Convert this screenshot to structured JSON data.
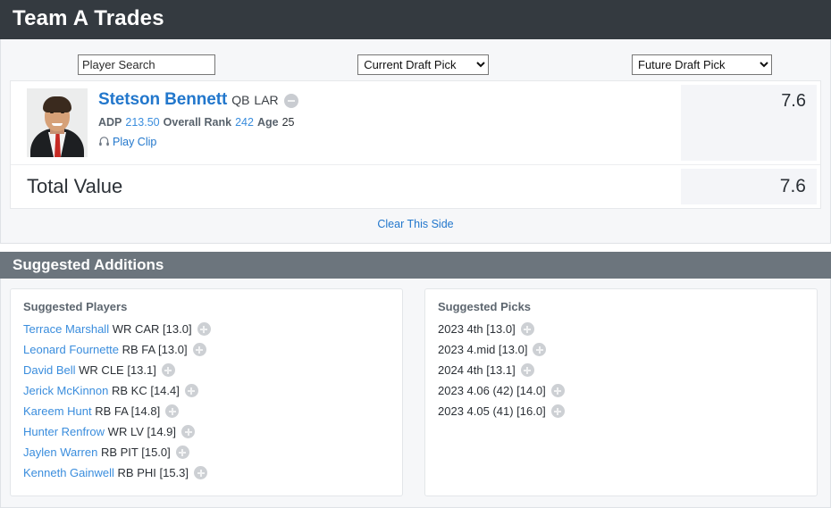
{
  "panel": {
    "title": "Team A Trades"
  },
  "controls": {
    "search_placeholder": "Player Search",
    "search_value": "",
    "current_pick_selected": "Current Draft Pick",
    "current_pick_options": [
      "Current Draft Pick"
    ],
    "future_pick_selected": "Future Draft Pick",
    "future_pick_options": [
      "Future Draft Pick"
    ]
  },
  "player_row": {
    "name": "Stetson Bennett",
    "position": "QB",
    "team": "LAR",
    "remove_icon": "minus-circle-icon",
    "adp_label": "ADP",
    "adp_value": "213.50",
    "rank_label": "Overall Rank",
    "rank_value": "242",
    "age_label": "Age",
    "age_value": "25",
    "clip_icon": "headphones-icon",
    "clip_label": "Play Clip",
    "value": "7.6"
  },
  "total": {
    "label": "Total Value",
    "value": "7.6"
  },
  "clear": {
    "label": "Clear This Side"
  },
  "suggested": {
    "title": "Suggested Additions",
    "players_heading": "Suggested Players",
    "picks_heading": "Suggested Picks",
    "players": [
      {
        "name": "Terrace Marshall",
        "rest": "WR CAR [13.0]"
      },
      {
        "name": "Leonard Fournette",
        "rest": "RB FA [13.0]"
      },
      {
        "name": "David Bell",
        "rest": "WR CLE [13.1]"
      },
      {
        "name": "Jerick McKinnon",
        "rest": "RB KC [14.4]"
      },
      {
        "name": "Kareem Hunt",
        "rest": "RB FA [14.8]"
      },
      {
        "name": "Hunter Renfrow",
        "rest": "WR LV [14.9]"
      },
      {
        "name": "Jaylen Warren",
        "rest": "RB PIT [15.0]"
      },
      {
        "name": "Kenneth Gainwell",
        "rest": "RB PHI [15.3]"
      }
    ],
    "picks": [
      {
        "label": "2023 4th [13.0]"
      },
      {
        "label": "2023 4.mid [13.0]"
      },
      {
        "label": "2024 4th [13.1]"
      },
      {
        "label": "2023 4.06 (42) [14.0]"
      },
      {
        "label": "2023 4.05 (41) [16.0]"
      }
    ]
  },
  "colors": {
    "title_bar": "#343a40",
    "section_bar": "#6c757d",
    "link": "#2277cc",
    "accent_blue": "#3a8ddd",
    "value_cell": "#f4f5f8"
  }
}
